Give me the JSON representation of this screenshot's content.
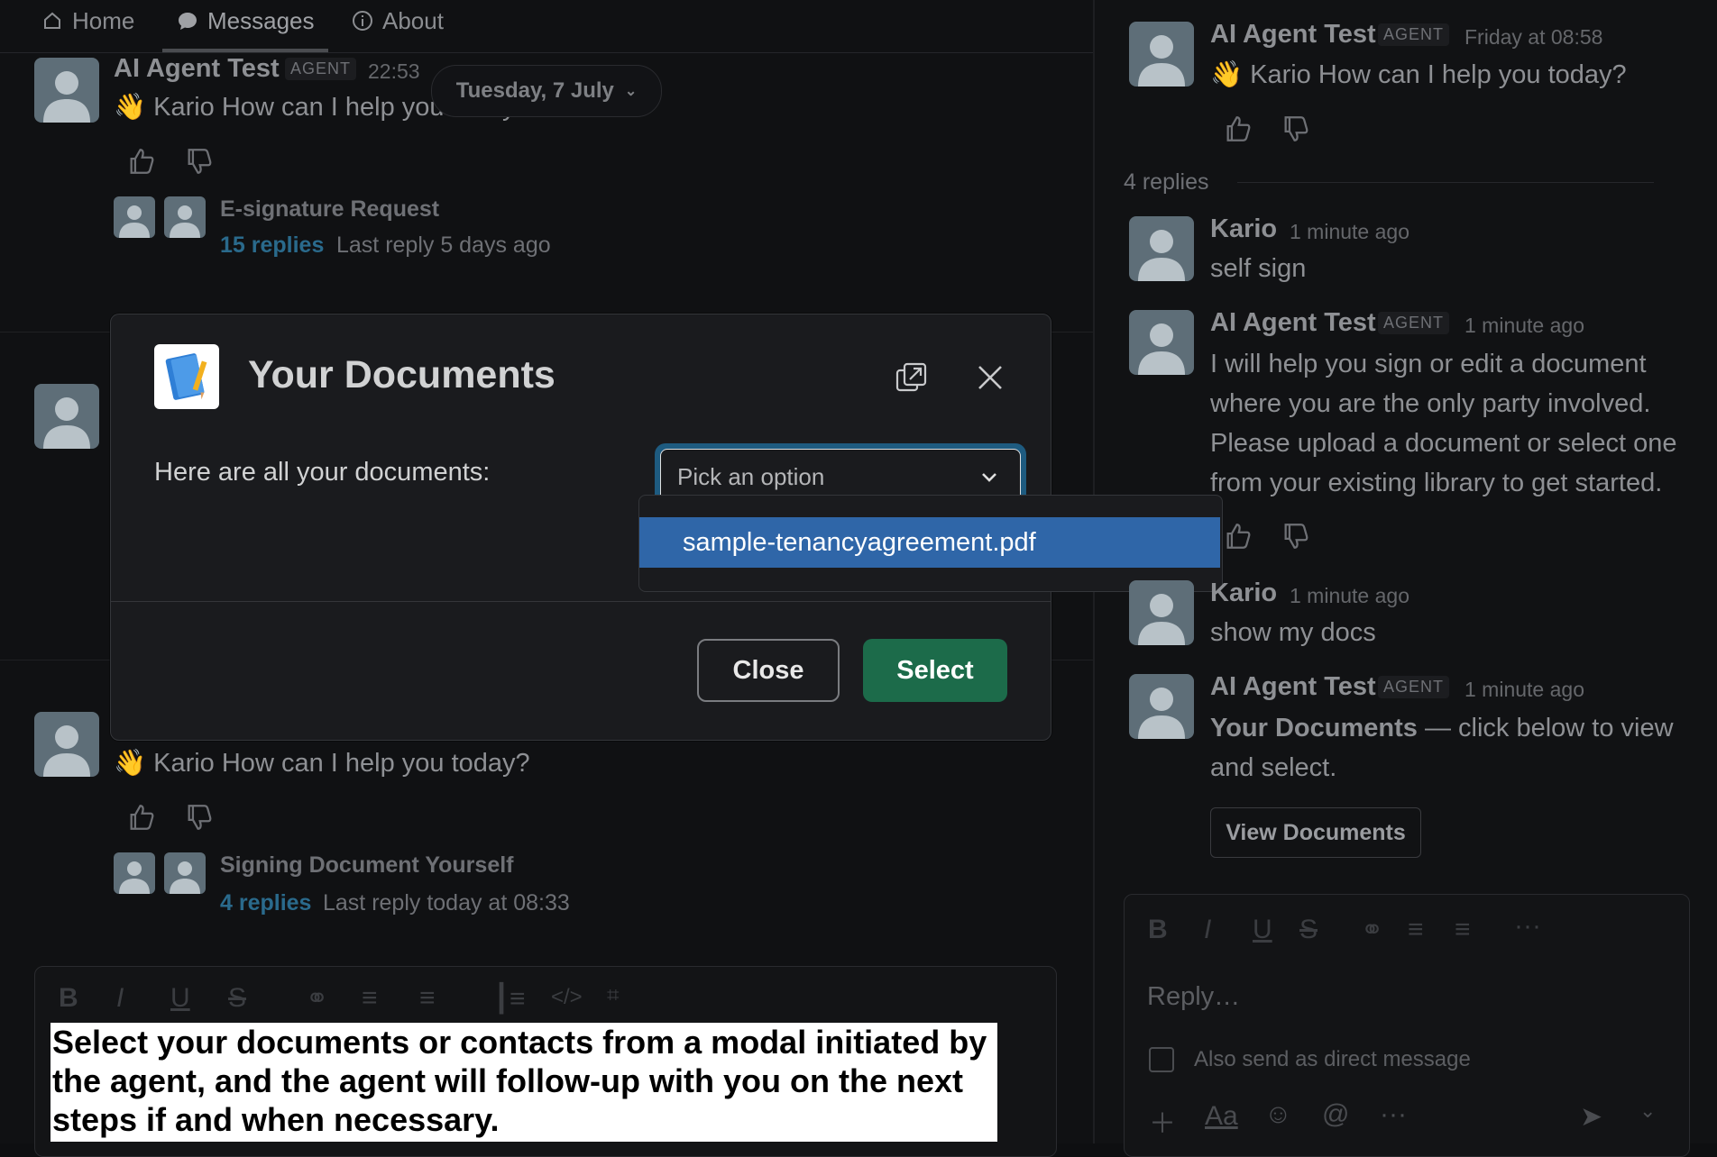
{
  "tabs": [
    {
      "label": "Home",
      "icon": "home-icon"
    },
    {
      "label": "Messages",
      "icon": "chat-bubble-icon"
    },
    {
      "label": "About",
      "icon": "info-icon"
    }
  ],
  "date_divider": "Tuesday, 7 July",
  "left_messages": [
    {
      "author": "AI Agent Test",
      "badge": "AGENT",
      "time": "22:53",
      "text": "Kario How can I help you today?",
      "thread_title": "E-signature Request",
      "replies": "15 replies",
      "last_reply": "Last reply 5 days ago"
    },
    {
      "text": "Kario How can I help you today?",
      "thread_title": "Signing Document Yourself",
      "replies": "4 replies",
      "last_reply": "Last reply today at 08:33"
    }
  ],
  "modal": {
    "title": "Your Documents",
    "label": "Here are all your documents:",
    "select_placeholder": "Pick an option",
    "options": [
      "sample-tenancyagreement.pdf"
    ],
    "close_label": "Close",
    "select_label": "Select"
  },
  "caption": "Select your documents or contacts from a modal initiated by the agent, and the agent will follow-up with you on the next steps if and when necessary.",
  "thread": {
    "root": {
      "author": "AI Agent Test",
      "badge": "AGENT",
      "time": "Friday at 08:58",
      "text": "Kario How can I help you today?"
    },
    "replies_count": "4 replies",
    "messages": [
      {
        "author": "Kario",
        "time": "1 minute ago",
        "text": "self sign"
      },
      {
        "author": "AI Agent Test",
        "badge": "AGENT",
        "time": "1 minute ago",
        "text": "I will help you sign or edit a document where you are the only party involved. Please upload a document or select one from your existing library to get started."
      },
      {
        "author": "Kario",
        "time": "1 minute ago",
        "text": "show my docs"
      },
      {
        "author": "AI Agent Test",
        "badge": "AGENT",
        "time": "1 minute ago",
        "text_bold": "Your Documents",
        "text": " — click below to view and select."
      }
    ],
    "view_button": "View Documents",
    "reply_placeholder": "Reply…",
    "also_send": "Also send as direct message"
  },
  "colors": {
    "accent_select": "#1c6b4a",
    "highlight": "#2f66a8",
    "link": "#2a6a8c"
  }
}
